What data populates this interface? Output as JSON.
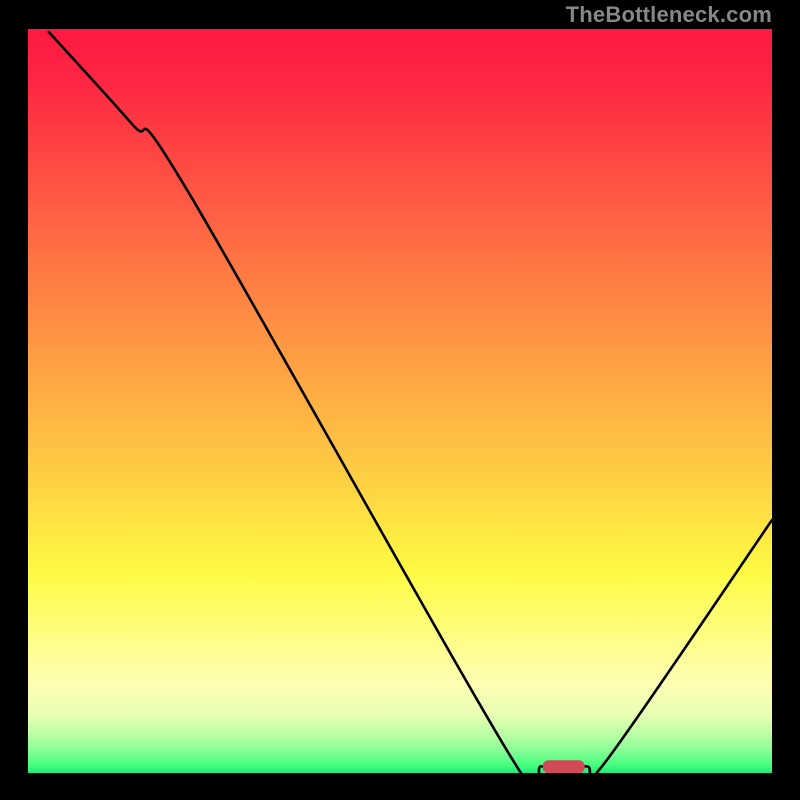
{
  "watermark": "TheBottleneck.com",
  "chart_data": {
    "type": "line",
    "title": "",
    "xlabel": "",
    "ylabel": "",
    "xlim": [
      0,
      100
    ],
    "ylim": [
      0,
      100
    ],
    "grid": false,
    "legend": false,
    "note": "Values estimated from pixel positions; y represents height from bottom of plot",
    "series": [
      {
        "name": "curve",
        "x": [
          2.8,
          14.0,
          21.6,
          65.0,
          69.0,
          75.0,
          78.0,
          100.0
        ],
        "y": [
          99.6,
          87.2,
          78.0,
          2.0,
          0.9,
          0.9,
          2.0,
          34.0
        ]
      }
    ],
    "marker": {
      "x": 72.0,
      "y": 0.9,
      "shape": "rounded-bar",
      "color": "#d14a57"
    },
    "background_gradient_colors": [
      "#fe1942",
      "#fe2643",
      "#fe5043",
      "#fe7b43",
      "#fea643",
      "#fece43",
      "#fefb43",
      "#fefe86",
      "#fefeb3",
      "#e8feb3",
      "#b7fea4",
      "#86fe95",
      "#43fe7e",
      "#22e77a"
    ]
  }
}
